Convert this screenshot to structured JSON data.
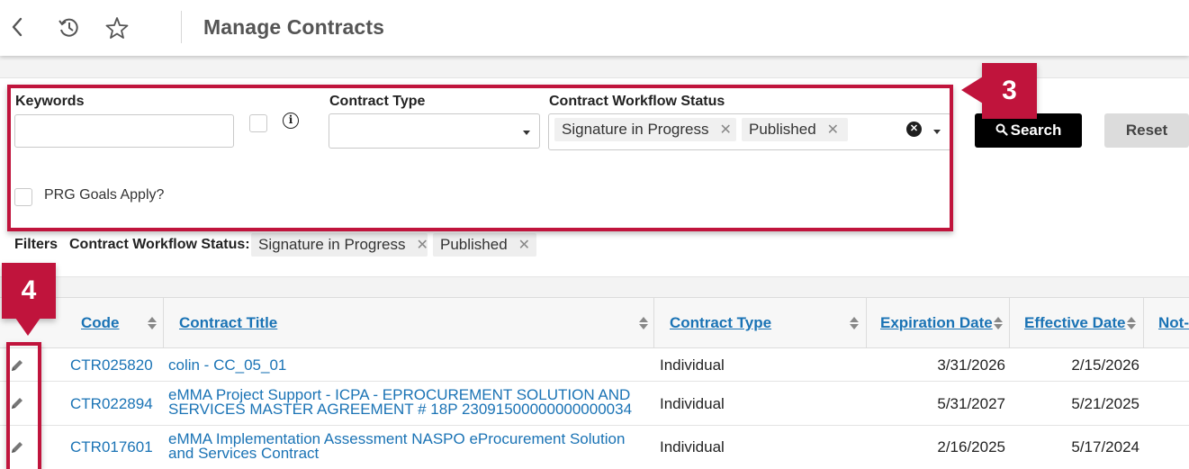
{
  "header": {
    "title": "Manage Contracts"
  },
  "filters_form": {
    "keywords_label": "Keywords",
    "keywords_value": "",
    "contract_type_label": "Contract Type",
    "contract_type_value": "",
    "workflow_status_label": "Contract Workflow Status",
    "workflow_status_selected": [
      "Signature in Progress",
      "Published"
    ],
    "prg_goals_label": "PRG Goals Apply?",
    "search_label": "Search",
    "reset_label": "Reset"
  },
  "active_filters": {
    "label": "Filters",
    "field_label": "Contract Workflow Status:",
    "values": [
      "Signature in Progress",
      "Published"
    ]
  },
  "annotations": {
    "badge_filters": "3",
    "badge_edit": "4"
  },
  "table": {
    "columns": [
      "Code",
      "Contract Title",
      "Contract Type",
      "Expiration Date",
      "Effective Date",
      "Not-"
    ],
    "rows": [
      {
        "code": "CTR025820",
        "title": "colin - CC_05_01",
        "type": "Individual",
        "expiration": "3/31/2026",
        "effective": "2/15/2026"
      },
      {
        "code": "CTR022894",
        "title_line1": "eMMA Project Support - ICPA - EPROCUREMENT SOLUTION AND",
        "title_line2": "SERVICES MASTER AGREEMENT # 18P 23091500000000000034",
        "type": "Individual",
        "expiration": "5/31/2027",
        "effective": "5/21/2025"
      },
      {
        "code": "CTR017601",
        "title_line1": "eMMA Implementation Assessment NASPO eProcurement Solution",
        "title_line2": "and Services Contract",
        "type": "Individual",
        "expiration": "2/16/2025",
        "effective": "5/17/2024"
      }
    ]
  },
  "colors": {
    "accent": "#c0143c",
    "link": "#1a73b5",
    "search_bg": "#000000"
  },
  "icons": [
    "back-icon",
    "history-icon",
    "star-icon",
    "info-icon",
    "search-icon",
    "clear-icon",
    "edit-icon"
  ]
}
